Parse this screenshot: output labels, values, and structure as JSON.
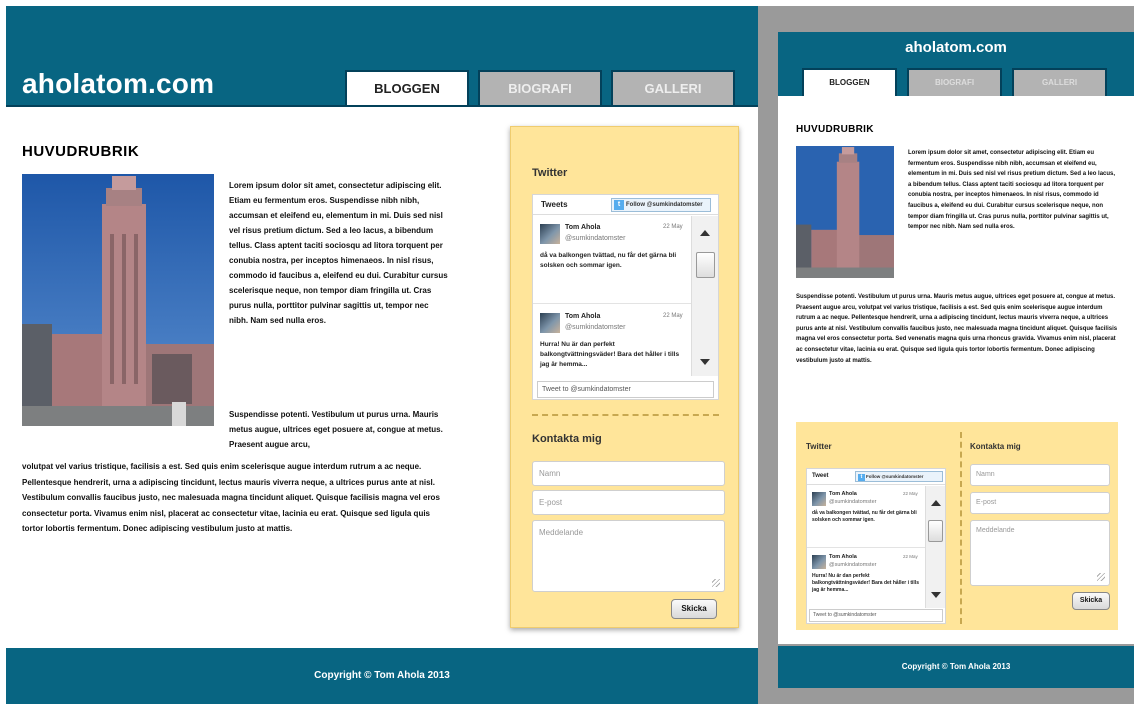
{
  "site": {
    "logo": "aholatom.com",
    "tabs": [
      {
        "label": "BLOGGEN",
        "active": true
      },
      {
        "label": "BIOGRAFI",
        "active": false
      },
      {
        "label": "GALLERI",
        "active": false
      }
    ]
  },
  "article": {
    "heading": "HUVUDRUBRIK",
    "image_icon": "helsinki-railway-station-photo",
    "paragraph1": "Lorem ipsum dolor sit amet, consectetur adipiscing elit. Etiam eu fermentum eros. Suspendisse nibh nibh, accumsan et eleifend eu, elementum in mi. Duis sed nisl vel risus pretium dictum. Sed a leo lacus, a bibendum tellus. Class aptent taciti sociosqu ad litora torquent per conubia nostra, per inceptos himenaeos. In nisl risus, commodo id faucibus a, eleifend eu dui. Curabitur cursus scelerisque neque, non tempor diam fringilla ut. Cras purus nulla, porttitor pulvinar sagittis ut, tempor nec nibh. Nam sed nulla eros.",
    "paragraph2_wrap": "Suspendisse potenti. Vestibulum ut purus urna. Mauris metus augue, ultrices eget posuere at, congue at metus. Praesent augue arcu,",
    "paragraph2_rest": "volutpat vel varius tristique, facilisis a est. Sed quis enim scelerisque augue interdum rutrum a ac neque. Pellentesque hendrerit, urna a adipiscing tincidunt, lectus mauris viverra neque, a ultrices purus ante at nisl. Vestibulum convallis faucibus justo, nec malesuada magna tincidunt aliquet. Quisque facilisis magna vel eros consectetur porta. Vivamus enim nisl, placerat ac consectetur vitae, lacinia eu erat. Quisque sed ligula quis tortor lobortis fermentum. Donec adipiscing vestibulum justo at mattis.",
    "paragraph2_full": "Suspendisse potenti. Vestibulum ut purus urna. Mauris metus augue, ultrices eget posuere at, congue at metus. Praesent augue arcu, volutpat vel varius tristique, facilisis a est. Sed quis enim scelerisque augue interdum rutrum a ac neque. Pellentesque hendrerit, urna a adipiscing tincidunt, lectus mauris viverra neque, a ultrices purus ante at nisl. Vestibulum convallis faucibus justo, nec malesuada magna tincidunt aliquet. Quisque facilisis magna vel eros consectetur porta. Sed venenatis magna quis urna rhoncus gravida. Vivamus enim nisl, placerat ac consectetur vitae, lacinia eu erat. Quisque sed ligula quis tortor lobortis fermentum. Donec adipiscing vestibulum justo at mattis."
  },
  "sidebar": {
    "twitter_heading": "Twitter",
    "tweets_label": "Tweets",
    "tweets_label_mobile": "Tweet",
    "follow_label": "Follow @sumkindatomster",
    "tweets": [
      {
        "name": "Tom Ahola",
        "handle": "@sumkindatomster",
        "date": "22 May",
        "text": "då va balkongen tvättad, nu får det gärna bli solsken och sommar igen."
      },
      {
        "name": "Tom Ahola",
        "handle": "@sumkindatomster",
        "date": "22 May",
        "text": "Hurra! Nu är dan perfekt balkongtvättningsväder! Bara det håller i tills jag är hemma..."
      }
    ],
    "mobile_tweets": [
      {
        "name": "Tom Ahola",
        "handle": "@sumkindatomster",
        "date": "22 May",
        "text": "då va balkongen tvättad, nu får det gärna bli solsken och sommar igen."
      },
      {
        "name": "Tom Ahola",
        "handle": "@sumkindatomster",
        "date": "22 May",
        "text": "Hurra! Nu är dan perfekt balkongtvättningsväder! Bara det håller i tills jag är hemma..."
      }
    ],
    "tweet_input_placeholder": "Tweet to @sumkindatomster",
    "contact_heading": "Kontakta mig",
    "name_placeholder": "Namn",
    "email_placeholder": "E-post",
    "message_placeholder": "Meddelande",
    "send_label": "Skicka"
  },
  "footer": {
    "copyright": "Copyright © Tom Ahola 2013"
  },
  "colors": {
    "header": "#086582",
    "sidebar": "#ffe59a",
    "inactive_tab": "#b3b3b3",
    "gutter": "#9a9a9a"
  }
}
